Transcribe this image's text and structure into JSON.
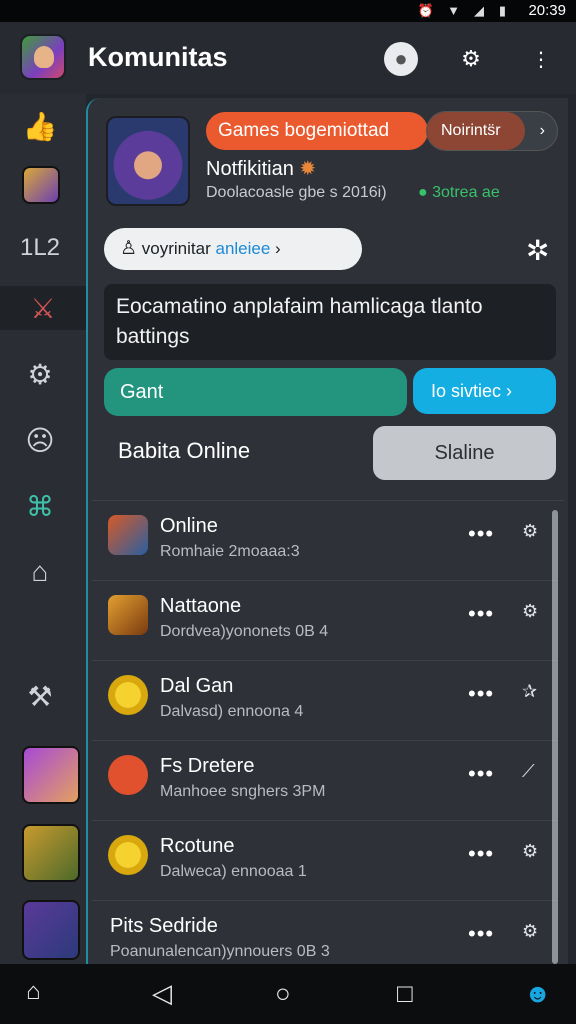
{
  "status": {
    "time": "20:39"
  },
  "app": {
    "title": "Komunitas"
  },
  "notification": {
    "pill_orange": "Games bogemiottad",
    "pill_dark": "Noirints̈r",
    "title": "Notfikitian",
    "subtitle": "Doolacoasle gbe s 2016i)",
    "badge": "3otrea ae"
  },
  "search": {
    "prefix": "voyrinitar",
    "accent": "anleiee"
  },
  "textbox": {
    "text": "Eocamatino anplafaim hamlicaga tlanto battings"
  },
  "buttons": {
    "teal": "Gant",
    "blue": "Io sivtiec",
    "grey": "Slaline"
  },
  "online_label": "Babita Online",
  "sidebar": {
    "text_item": "1L2"
  },
  "list": [
    {
      "name": "Online",
      "sub": "Romhaie 2moaaa:3",
      "avatar_color": "#d65a28",
      "action": "gear-icon"
    },
    {
      "name": "Nattaone",
      "sub": "Dordvea)yononets 0B 4",
      "avatar_color": "#c57b23",
      "action": "gear-icon"
    },
    {
      "name": "Dal Gan",
      "sub": "Dalvasd) ennoona 4",
      "avatar_color": "#f0c419",
      "action": "star-icon"
    },
    {
      "name": "Fs Dretere",
      "sub": "Manhoee snghers 3PM",
      "avatar_color": "#e2512d",
      "action": "pin-icon"
    },
    {
      "name": "Rcotune",
      "sub": "Dalweca) ennooaa 1",
      "avatar_color": "#f0c419",
      "action": "gear-icon"
    },
    {
      "name": "Pits Sedride",
      "sub": "Poanunalencan)ynnouers 0B 3",
      "avatar_color": "",
      "action": "gear-icon"
    }
  ]
}
